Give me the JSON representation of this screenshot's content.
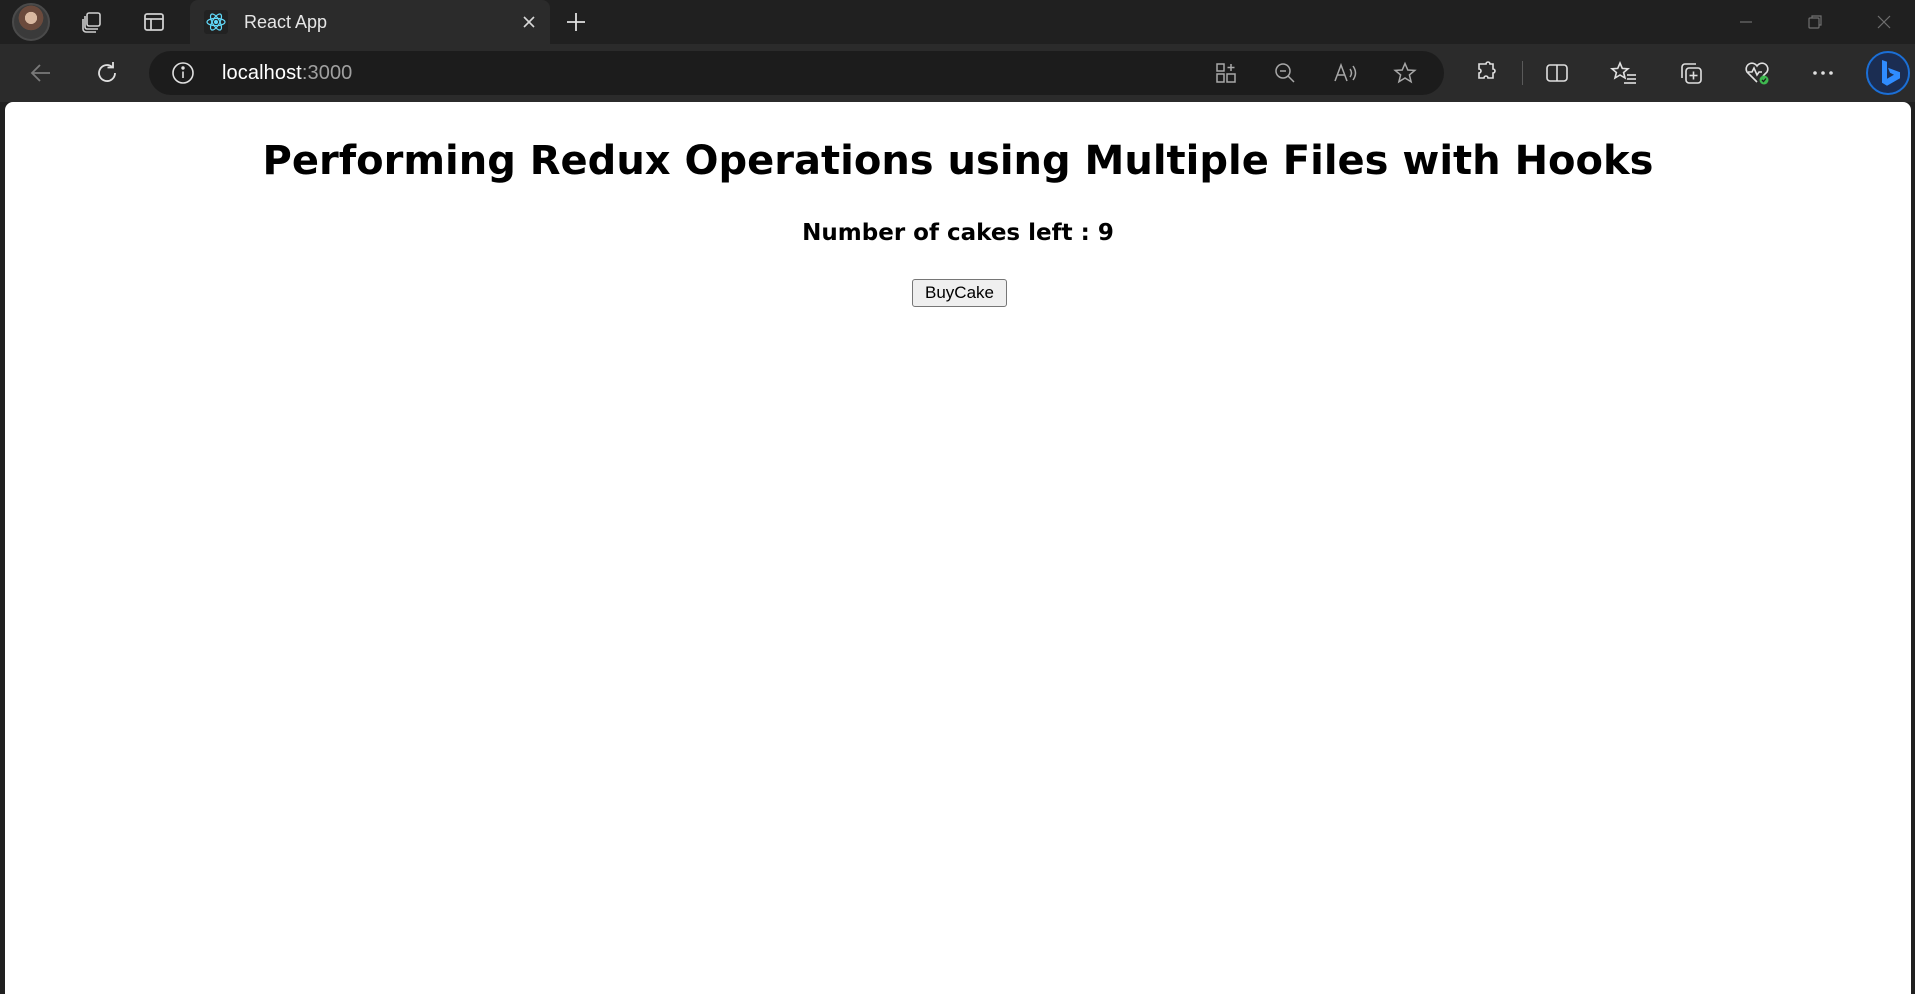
{
  "browser": {
    "tab": {
      "title": "React App",
      "favicon": "react-logo-icon"
    },
    "address_bar": {
      "host": "localhost",
      "port": ":3000"
    },
    "colors": {
      "accent_bing": "#1b6fd6",
      "react_blue": "#61dafb",
      "health_green": "#3fb950"
    }
  },
  "page": {
    "heading": "Performing Redux Operations using Multiple Files with Hooks",
    "cakes_label": "Number of cakes left : 9",
    "buy_button_label": "BuyCake"
  }
}
